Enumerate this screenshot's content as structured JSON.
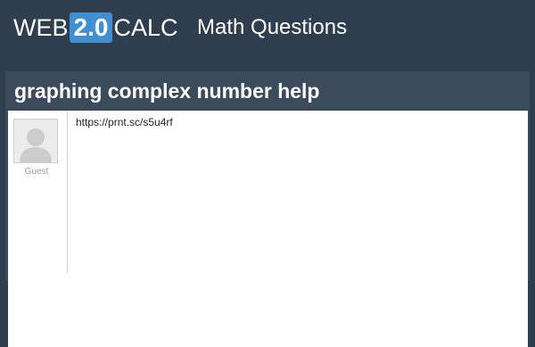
{
  "header": {
    "logo": {
      "web": "WEB",
      "version": "2.0",
      "calc": "CALC"
    },
    "section": "Math Questions"
  },
  "question": {
    "title": "graphing complex number help",
    "author": "Guest",
    "body": "https://prnt.sc/s5u4rf"
  },
  "colors": {
    "background": "#2f3e4e",
    "panel": "#3b4b5b",
    "logo_accent": "#3f8fd2"
  },
  "icons": {
    "avatar": "user-silhouette-icon"
  }
}
